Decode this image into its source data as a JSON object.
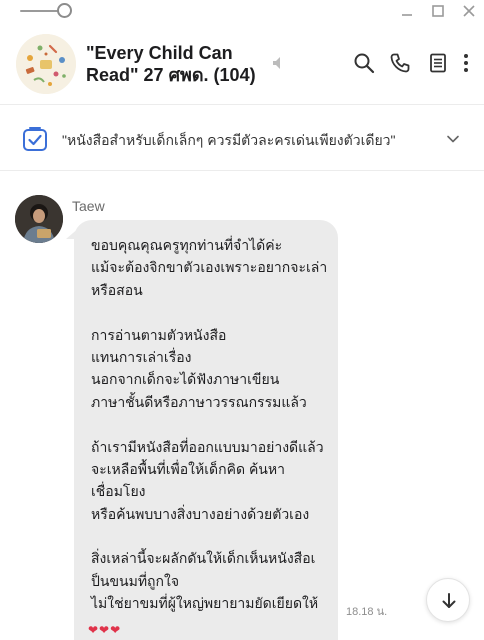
{
  "window": {
    "icons": [
      "zoom-slider",
      "minimize-icon",
      "maximize-icon",
      "close-icon"
    ]
  },
  "header": {
    "title_line1": "\"Every Child Can",
    "title_line2": "Read\" 27 ศพด. (104)",
    "icons": [
      "group-avatar",
      "mute-icon",
      "search-icon",
      "phone-icon",
      "notes-icon",
      "more-vertical-icon"
    ]
  },
  "announcement": {
    "text": "\"หนังสือสำหรับเด็กเล็กๆ ควรมีตัวละครเด่นเพียงตัวเดียว\"",
    "icon": "announcement-check-icon",
    "accent": "#3b6fd8"
  },
  "chat": {
    "sender": "Taew",
    "message_lines": [
      "ขอบคุณคุณครูทุกท่านที่จำได้ค่ะ",
      "แม้จะต้องจิกขาตัวเองเพราะอยากจะเล่า",
      "หรือสอน",
      "",
      "การอ่านตามตัวหนังสือ",
      "แทนการเล่าเรื่อง",
      "นอกจากเด็กจะได้ฟังภาษาเขียน",
      "ภาษาชั้นดีหรือภาษาวรรณกรรมแล้ว",
      "",
      "ถ้าเรามีหนังสือที่ออกแบบมาอย่างดีแล้ว",
      "จะเหลือพื้นที่เพื่อให้เด็กคิด ค้นหา",
      "เชื่อมโยง",
      "หรือค้นพบบางสิ่งบางอย่างด้วยตัวเอง",
      "",
      "สิ่งเหล่านี้จะผลักดันให้เด็กเห็นหนังสือเ",
      "ป็นขนมที่ถูกใจ",
      "ไม่ใช่ยาขมที่ผู้ใหญ่พยายามยัดเยียดให้"
    ],
    "timestamp": "18.18 น.",
    "reactions": "❤❤❤",
    "bubble_color": "#ebebeb"
  }
}
